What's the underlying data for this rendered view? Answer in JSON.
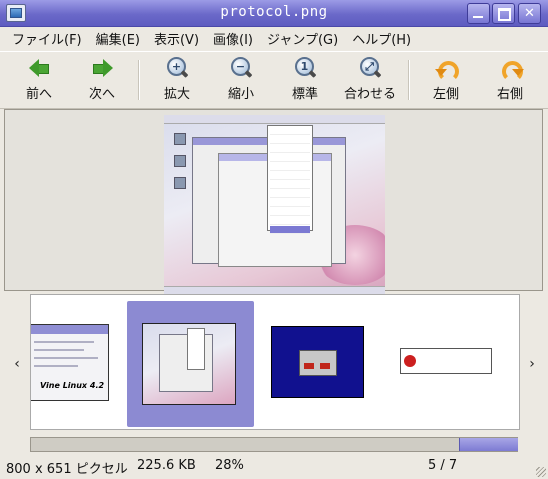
{
  "window": {
    "title": "protocol.png",
    "icons": [
      "image-viewer-app-icon",
      "minimize-icon",
      "maximize-icon",
      "close-icon"
    ]
  },
  "menu": [
    "ファイル(F)",
    "編集(E)",
    "表示(V)",
    "画像(I)",
    "ジャンプ(G)",
    "ヘルプ(H)"
  ],
  "toolbar": {
    "prev": "前へ",
    "next": "次へ",
    "zoom_in": "拡大",
    "zoom_out": "縮小",
    "normal": "標準",
    "fit": "合わせる",
    "rotate_left": "左側",
    "rotate_right": "右側"
  },
  "thumbnails": {
    "first_caption": "Vine Linux 4.2",
    "prev_arrow": "‹",
    "next_arrow": "›"
  },
  "status": {
    "dimensions": "800 x 651 ピクセル",
    "filesize": "225.6 KB",
    "zoom": "28%",
    "position": "5 / 7"
  },
  "colors": {
    "titlebar": "#6b69c9",
    "selection": "#8c8ad2",
    "background": "#ece9e2"
  }
}
